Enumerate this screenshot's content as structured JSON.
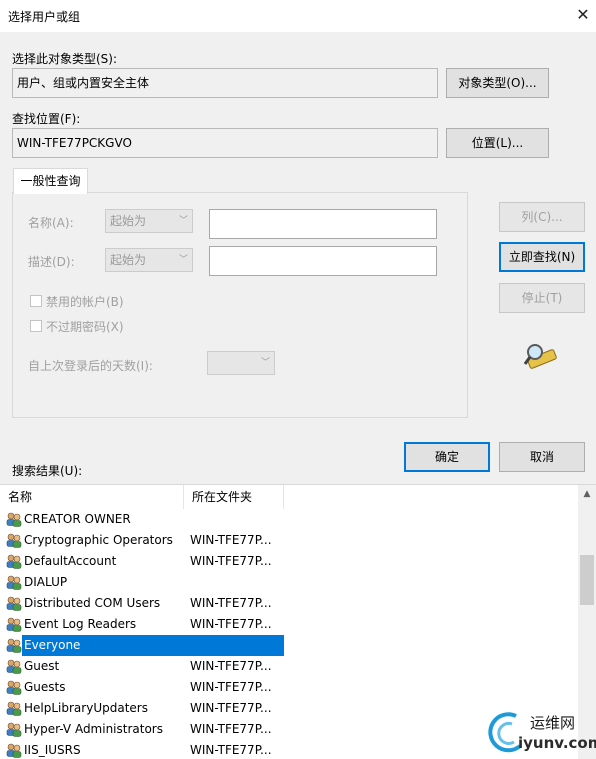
{
  "window": {
    "title": "选择用户或组",
    "close_glyph": "✕"
  },
  "object_types": {
    "label": "选择此对象类型(S):",
    "value": "用户、组或内置安全主体",
    "button": "对象类型(O)..."
  },
  "location": {
    "label": "查找位置(F):",
    "value": "WIN-TFE77PCKGVO",
    "button": "位置(L)..."
  },
  "query": {
    "tab_label": "一般性查询",
    "name_label": "名称(A):",
    "name_mode": "起始为",
    "desc_label": "描述(D):",
    "desc_mode": "起始为",
    "disabled_accounts": "禁用的帐户(B)",
    "non_expiring": "不过期密码(X)",
    "days_label": "自上次登录后的天数(I):"
  },
  "side_buttons": {
    "columns": "列(C)...",
    "find_now": "立即查找(N)",
    "stop": "停止(T)"
  },
  "dialog_buttons": {
    "ok": "确定",
    "cancel": "取消"
  },
  "results": {
    "label": "搜索结果(U):",
    "columns": [
      "名称",
      "所在文件夹"
    ],
    "rows": [
      {
        "name": "CREATOR OWNER",
        "folder": ""
      },
      {
        "name": "Cryptographic Operators",
        "folder": "WIN-TFE77P..."
      },
      {
        "name": "DefaultAccount",
        "folder": "WIN-TFE77P..."
      },
      {
        "name": "DIALUP",
        "folder": ""
      },
      {
        "name": "Distributed COM Users",
        "folder": "WIN-TFE77P..."
      },
      {
        "name": "Event Log Readers",
        "folder": "WIN-TFE77P..."
      },
      {
        "name": "Everyone",
        "folder": ""
      },
      {
        "name": "Guest",
        "folder": "WIN-TFE77P..."
      },
      {
        "name": "Guests",
        "folder": "WIN-TFE77P..."
      },
      {
        "name": "HelpLibraryUpdaters",
        "folder": "WIN-TFE77P..."
      },
      {
        "name": "Hyper-V Administrators",
        "folder": "WIN-TFE77P..."
      },
      {
        "name": "IIS_IUSRS",
        "folder": "WIN-TFE77P..."
      }
    ],
    "selected_index": 6
  },
  "watermark": {
    "line1": "运维网",
    "line2": "iyunv.com"
  },
  "colors": {
    "accent": "#0078d7",
    "selection": "#0078d7",
    "dialog_bg": "#f0f0f0"
  }
}
